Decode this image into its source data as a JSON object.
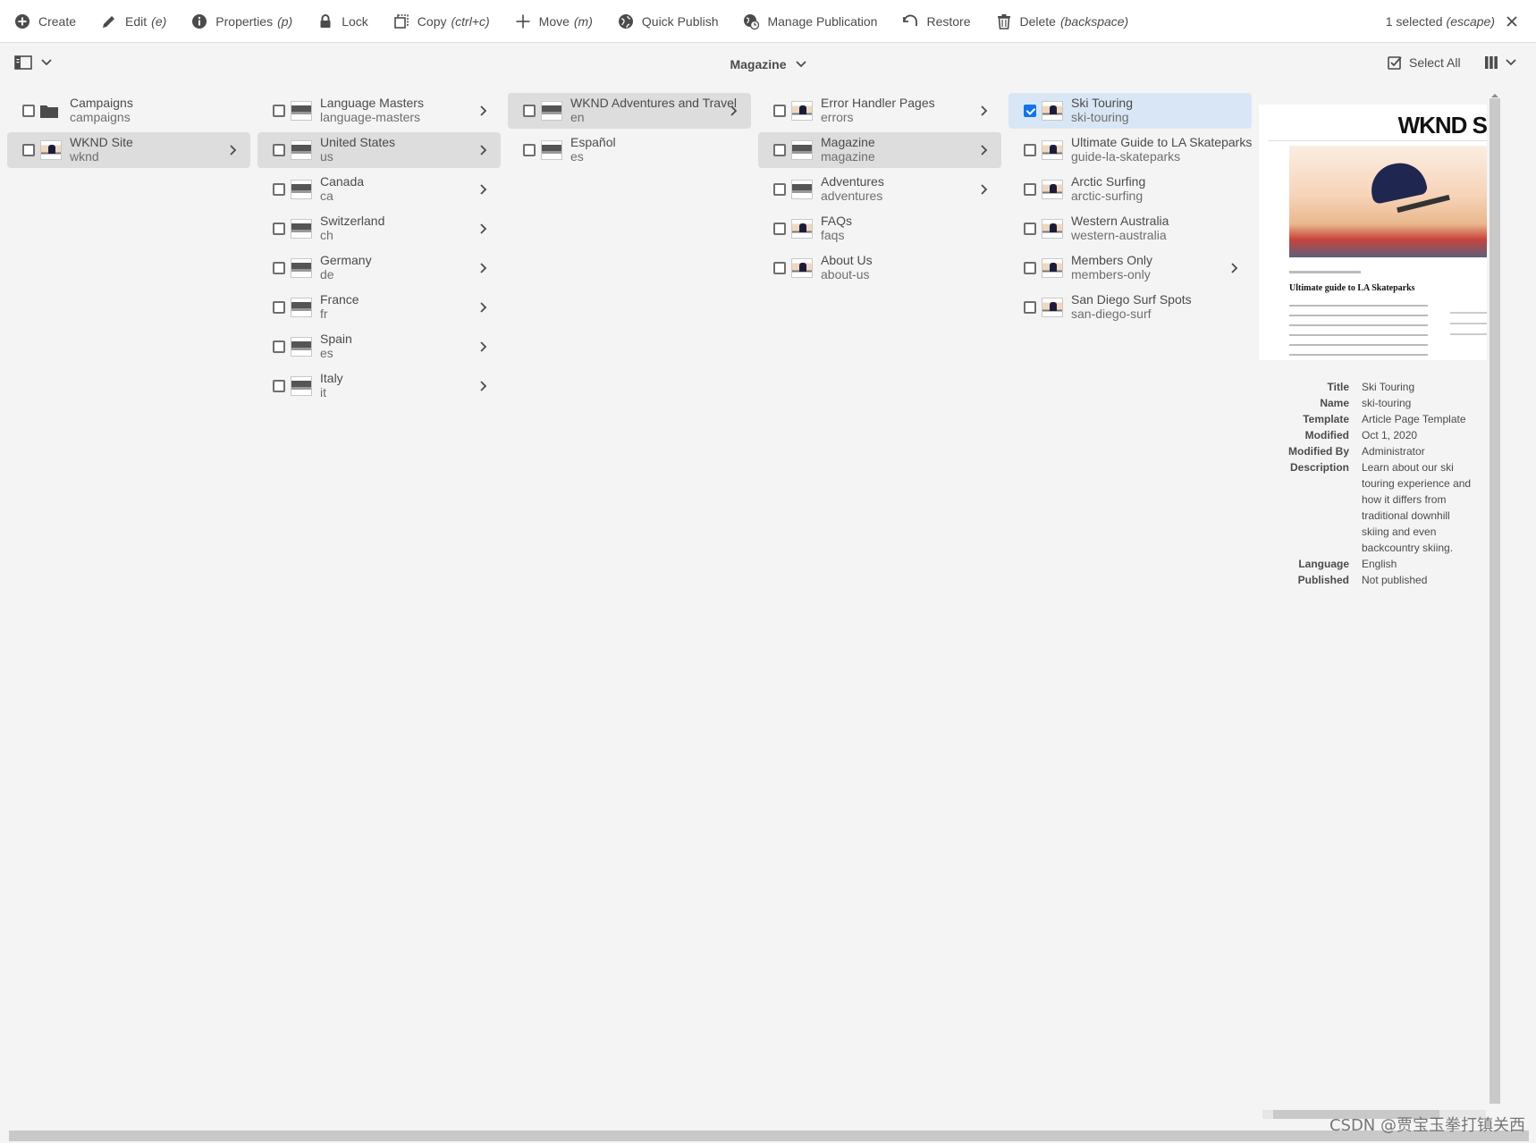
{
  "actionbar": {
    "actions": [
      {
        "label": "Create",
        "shortcut": ""
      },
      {
        "label": "Edit",
        "shortcut": "(e)"
      },
      {
        "label": "Properties",
        "shortcut": "(p)"
      },
      {
        "label": "Lock",
        "shortcut": ""
      },
      {
        "label": "Copy",
        "shortcut": "(ctrl+c)"
      },
      {
        "label": "Move",
        "shortcut": "(m)"
      },
      {
        "label": "Quick Publish",
        "shortcut": ""
      },
      {
        "label": "Manage Publication",
        "shortcut": ""
      },
      {
        "label": "Restore",
        "shortcut": ""
      },
      {
        "label": "Delete",
        "shortcut": "(backspace)"
      }
    ],
    "selection": {
      "count_label": "1 selected",
      "shortcut": "(escape)"
    }
  },
  "subbar": {
    "breadcrumb": "Magazine",
    "select_all": "Select All"
  },
  "columns": [
    {
      "items": [
        {
          "title": "Campaigns",
          "name": "campaigns"
        },
        {
          "title": "WKND Site",
          "name": "wknd"
        }
      ]
    },
    {
      "items": [
        {
          "title": "Language Masters",
          "name": "language-masters"
        },
        {
          "title": "United States",
          "name": "us"
        },
        {
          "title": "Canada",
          "name": "ca"
        },
        {
          "title": "Switzerland",
          "name": "ch"
        },
        {
          "title": "Germany",
          "name": "de"
        },
        {
          "title": "France",
          "name": "fr"
        },
        {
          "title": "Spain",
          "name": "es"
        },
        {
          "title": "Italy",
          "name": "it"
        }
      ]
    },
    {
      "items": [
        {
          "title": "WKND Adventures and Travel",
          "name": "en"
        },
        {
          "title": "Español",
          "name": "es"
        }
      ]
    },
    {
      "items": [
        {
          "title": "Error Handler Pages",
          "name": "errors"
        },
        {
          "title": "Magazine",
          "name": "magazine"
        },
        {
          "title": "Adventures",
          "name": "adventures"
        },
        {
          "title": "FAQs",
          "name": "faqs"
        },
        {
          "title": "About Us",
          "name": "about-us"
        }
      ]
    },
    {
      "items": [
        {
          "title": "Ski Touring",
          "name": "ski-touring"
        },
        {
          "title": "Ultimate Guide to LA Skateparks",
          "name": "guide-la-skateparks"
        },
        {
          "title": "Arctic Surfing",
          "name": "arctic-surfing"
        },
        {
          "title": "Western Australia",
          "name": "western-australia"
        },
        {
          "title": "Members Only",
          "name": "members-only"
        },
        {
          "title": "San Diego Surf Spots",
          "name": "san-diego-surf"
        }
      ]
    }
  ],
  "preview": {
    "brand": "WKND S",
    "article_title": "Ultimate guide to LA Skateparks"
  },
  "meta": {
    "rows": [
      {
        "key": "Title",
        "value": "Ski Touring"
      },
      {
        "key": "Name",
        "value": "ski-touring"
      },
      {
        "key": "Template",
        "value": "Article Page Template"
      },
      {
        "key": "Modified",
        "value": "Oct 1, 2020"
      },
      {
        "key": "Modified By",
        "value": "Administrator"
      },
      {
        "key": "Description",
        "value": "Learn about our ski touring experience and how it differs from traditional downhill skiing and even backcountry skiing."
      },
      {
        "key": "Language",
        "value": "English"
      },
      {
        "key": "Published",
        "value": "Not published"
      }
    ]
  },
  "watermark": "CSDN @贾宝玉拳打镇关西"
}
